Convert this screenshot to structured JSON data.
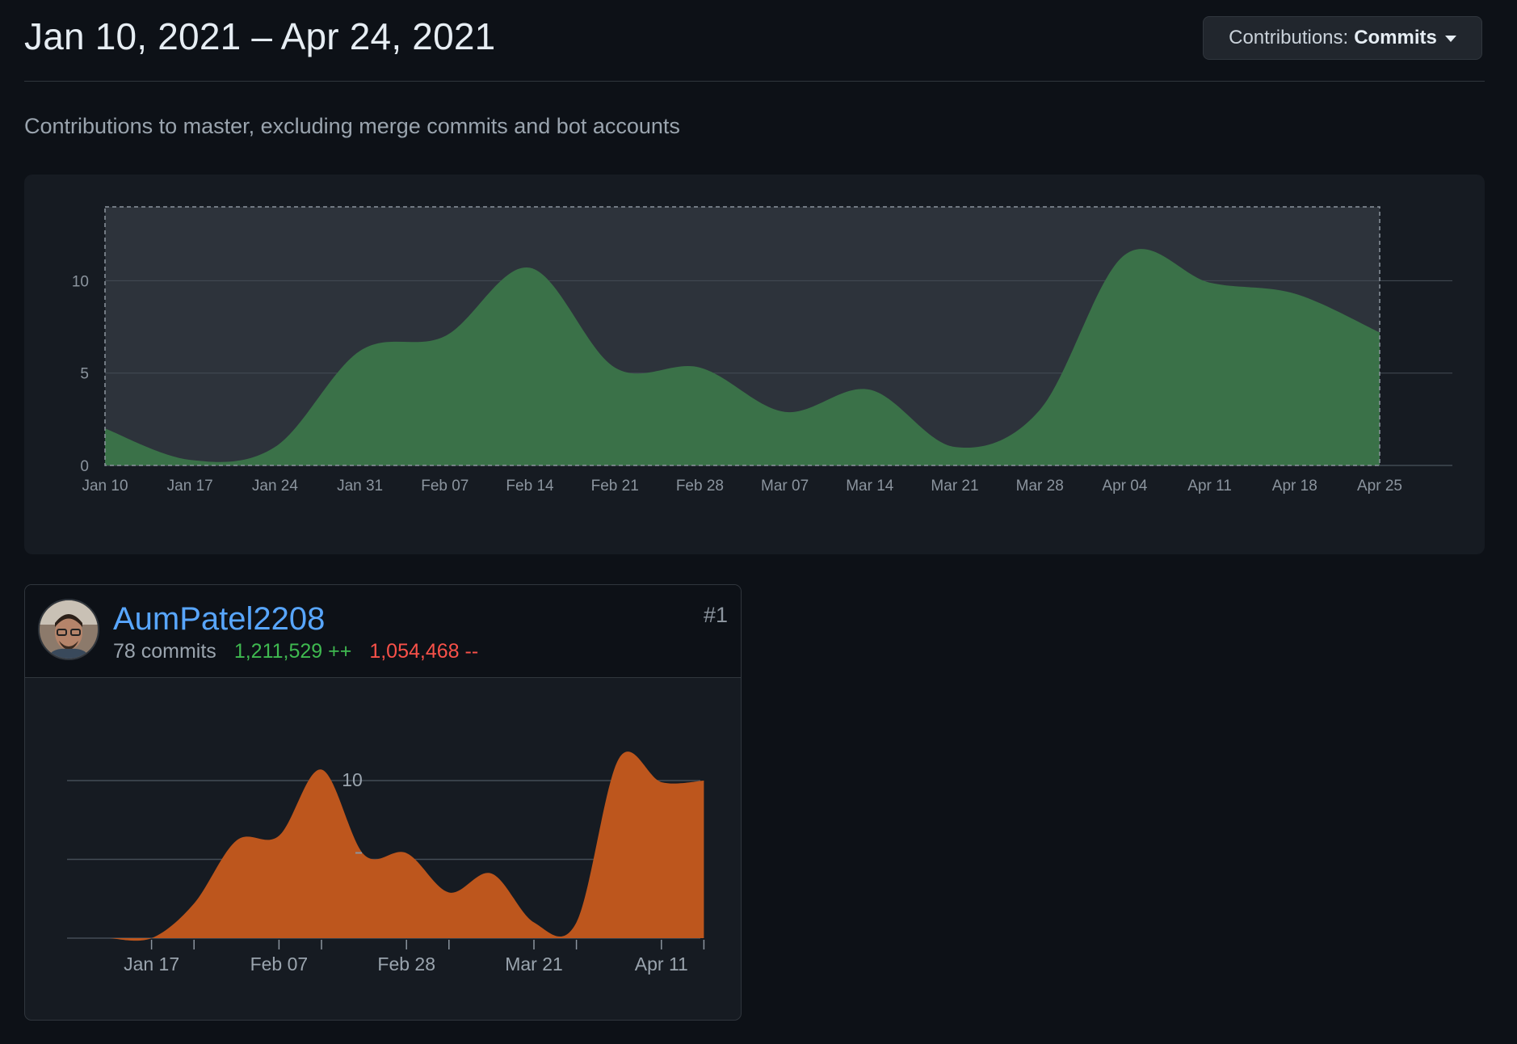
{
  "header": {
    "date_range": "Jan 10, 2021 – Apr 24, 2021",
    "contributions_label": "Contributions:",
    "contributions_value": "Commits",
    "subtitle": "Contributions to master, excluding merge commits and bot accounts"
  },
  "colors": {
    "background": "#0d1117",
    "panel": "#161b22",
    "area_green": "#3a7148",
    "area_orange": "#bd561d",
    "link_blue": "#58a6ff",
    "additions_green": "#3fb950",
    "deletions_red": "#f85149"
  },
  "chart_data": [
    {
      "type": "area",
      "title": "",
      "xlabel": "",
      "ylabel": "",
      "x": [
        "Jan 10",
        "Jan 17",
        "Jan 24",
        "Jan 31",
        "Feb 07",
        "Feb 14",
        "Feb 21",
        "Feb 28",
        "Mar 07",
        "Mar 14",
        "Mar 21",
        "Mar 28",
        "Apr 04",
        "Apr 11",
        "Apr 18",
        "Apr 25"
      ],
      "series": [
        {
          "values": [
            2,
            0.3,
            1,
            6.2,
            7,
            10.7,
            5.3,
            5.3,
            2.9,
            4.1,
            1,
            3,
            11.4,
            9.9,
            9.3,
            7.2
          ]
        }
      ],
      "ylim": [
        0,
        14
      ],
      "yticks": [
        0,
        5,
        10
      ],
      "grid": true,
      "selection": {
        "from": "Jan 10",
        "to": "Apr 25"
      }
    },
    {
      "type": "area",
      "title": "",
      "x": [
        "Jan 10",
        "Jan 17",
        "Jan 24",
        "Jan 31",
        "Feb 07",
        "Feb 14",
        "Feb 21",
        "Feb 28",
        "Mar 07",
        "Mar 14",
        "Mar 21",
        "Mar 28",
        "Apr 04",
        "Apr 11",
        "Apr 18"
      ],
      "xtick_labels": [
        "Jan 17",
        "Feb 07",
        "Feb 28",
        "Mar 21",
        "Apr 11"
      ],
      "series": [
        {
          "values": [
            0,
            0,
            2.2,
            6.2,
            6.5,
            10.7,
            5.3,
            5.4,
            2.9,
            4.1,
            1,
            1,
            11.4,
            9.9,
            10
          ]
        }
      ],
      "ylim": [
        0,
        10
      ],
      "yticks": [
        5,
        10
      ],
      "ytick_labels": [
        "",
        "10"
      ],
      "grid": true
    }
  ],
  "contributor": {
    "username": "AumPatel2208",
    "rank": "#1",
    "commits": "78 commits",
    "additions": "1,211,529 ++",
    "deletions": "1,054,468 --"
  }
}
